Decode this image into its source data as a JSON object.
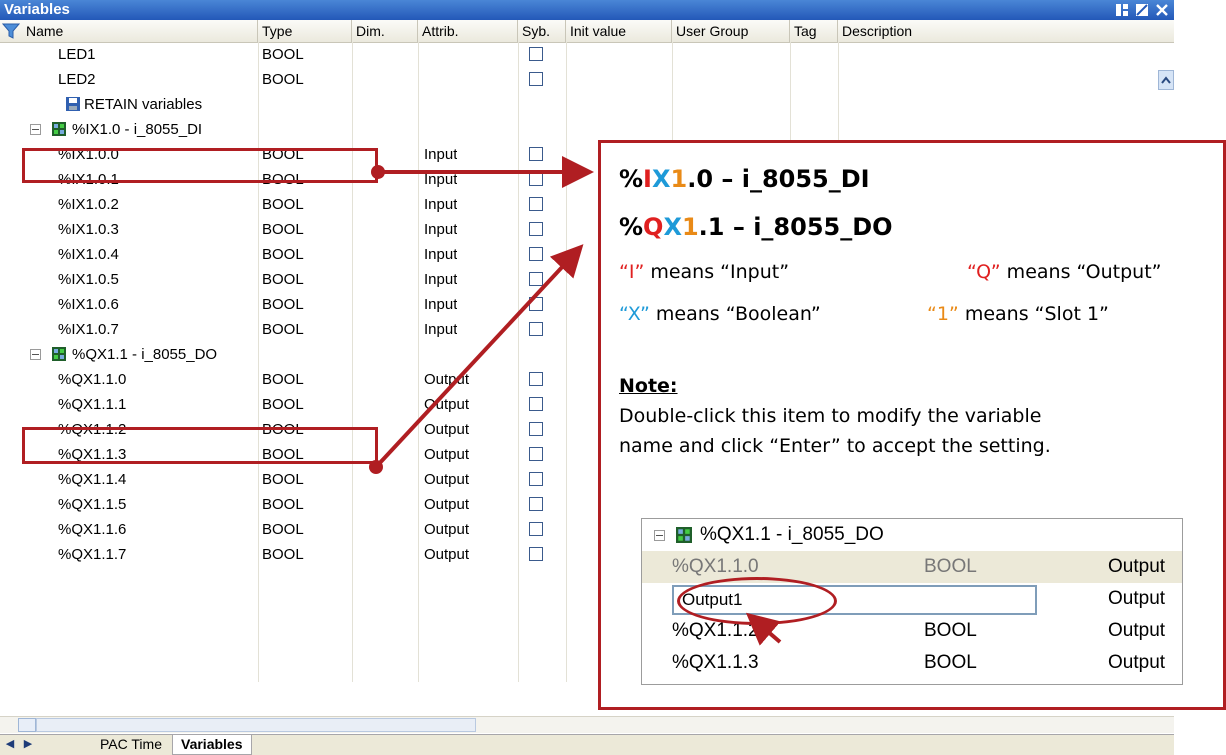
{
  "window": {
    "title": "Variables"
  },
  "columns": [
    "Name",
    "Type",
    "Dim.",
    "Attrib.",
    "Syb.",
    "Init value",
    "User Group",
    "Tag",
    "Description"
  ],
  "top_rows": [
    {
      "name": "LED1",
      "type": "BOOL"
    },
    {
      "name": "LED2",
      "type": "BOOL"
    }
  ],
  "retain_label": "RETAIN variables",
  "groups": [
    {
      "label": "%IX1.0 - i_8055_DI",
      "rows": [
        {
          "name": "%IX1.0.0",
          "type": "BOOL",
          "attrib": "Input"
        },
        {
          "name": "%IX1.0.1",
          "type": "BOOL",
          "attrib": "Input"
        },
        {
          "name": "%IX1.0.2",
          "type": "BOOL",
          "attrib": "Input"
        },
        {
          "name": "%IX1.0.3",
          "type": "BOOL",
          "attrib": "Input"
        },
        {
          "name": "%IX1.0.4",
          "type": "BOOL",
          "attrib": "Input"
        },
        {
          "name": "%IX1.0.5",
          "type": "BOOL",
          "attrib": "Input"
        },
        {
          "name": "%IX1.0.6",
          "type": "BOOL",
          "attrib": "Input"
        },
        {
          "name": "%IX1.0.7",
          "type": "BOOL",
          "attrib": "Input"
        }
      ]
    },
    {
      "label": "%QX1.1 - i_8055_DO",
      "rows": [
        {
          "name": "%QX1.1.0",
          "type": "BOOL",
          "attrib": "Output"
        },
        {
          "name": "%QX1.1.1",
          "type": "BOOL",
          "attrib": "Output"
        },
        {
          "name": "%QX1.1.2",
          "type": "BOOL",
          "attrib": "Output"
        },
        {
          "name": "%QX1.1.3",
          "type": "BOOL",
          "attrib": "Output"
        },
        {
          "name": "%QX1.1.4",
          "type": "BOOL",
          "attrib": "Output"
        },
        {
          "name": "%QX1.1.5",
          "type": "BOOL",
          "attrib": "Output"
        },
        {
          "name": "%QX1.1.6",
          "type": "BOOL",
          "attrib": "Output"
        },
        {
          "name": "%QX1.1.7",
          "type": "BOOL",
          "attrib": "Output"
        }
      ]
    }
  ],
  "tabs": [
    {
      "label": "PAC Time",
      "active": false
    },
    {
      "label": "Variables",
      "active": true
    }
  ],
  "callout": {
    "line1": {
      "p1": "%",
      "p2": "I",
      "p3": "X",
      "p4": "1",
      "p5": ".0 – i_8055_DI"
    },
    "line2": {
      "p1": "%",
      "p2": "Q",
      "p3": "X",
      "p4": "1",
      "p5": ".1 – i_8055_DO"
    },
    "legend": [
      {
        "quoted": "“I”",
        "text": " means “Input”"
      },
      {
        "quoted": "“Q”",
        "text": " means “Output”"
      },
      {
        "quoted": "“X”",
        "text": " means “Boolean”"
      },
      {
        "quoted": "“1”",
        "text": " means “Slot 1”"
      }
    ],
    "note_title": "Note:",
    "note_line1": "Double-click this item to modify the variable",
    "note_line2": "name and click “Enter” to accept the setting.",
    "inset": {
      "group_label": "%QX1.1 - i_8055_DO",
      "edit_value": "Output1",
      "rows": [
        {
          "name": "%QX1.1.0",
          "type": "BOOL",
          "attrib": "Output"
        },
        {
          "name": "",
          "type": "",
          "attrib": "Output"
        },
        {
          "name": "%QX1.1.2",
          "type": "BOOL",
          "attrib": "Output"
        },
        {
          "name": "%QX1.1.3",
          "type": "BOOL",
          "attrib": "Output"
        }
      ]
    }
  },
  "colors": {
    "accent_red": "#b01e22",
    "input": "#e02020",
    "boolean": "#1e9ad8",
    "slot": "#e98a17",
    "titlebar": "#2358b8"
  }
}
